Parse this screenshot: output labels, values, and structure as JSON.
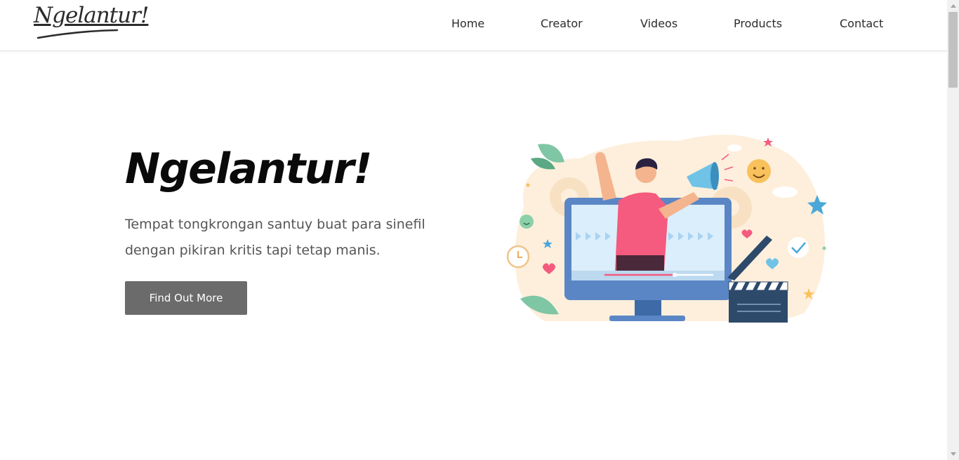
{
  "brand": {
    "logo_text": "Ngelantur!"
  },
  "nav": {
    "items": [
      {
        "label": "Home"
      },
      {
        "label": "Creator"
      },
      {
        "label": "Videos"
      },
      {
        "label": "Products"
      },
      {
        "label": "Contact"
      }
    ]
  },
  "hero": {
    "title": "Ngelantur!",
    "subtitle": "Tempat tongkrongan santuy buat para sinefil dengan pikiran kritis tapi tetap manis.",
    "cta_label": "Find Out More"
  },
  "colors": {
    "button": "#6b6b6b",
    "accent_pink": "#f45b7e",
    "accent_blue": "#5b86c5",
    "blob": "#fdefdc"
  }
}
